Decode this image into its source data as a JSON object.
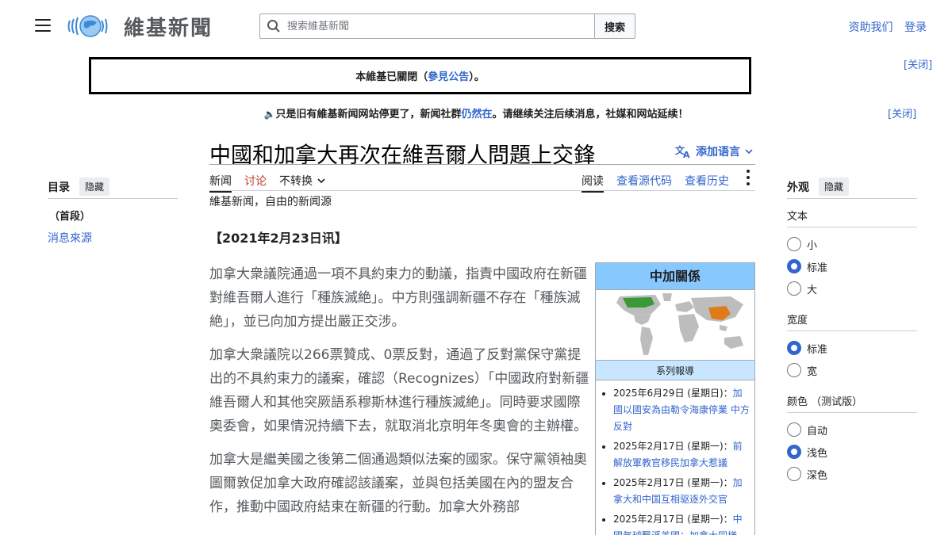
{
  "header": {
    "wordmark": "維基新聞",
    "search_placeholder": "搜索維基新聞",
    "search_button": "搜索",
    "donate": "资助我们",
    "login": "登录"
  },
  "notices": {
    "closed_prefix": "本維基已關閉（",
    "closed_link": "參見公告",
    "closed_suffix": "）。",
    "close_label": "[关闭]",
    "second_prefix": "只是旧有維基新闻网站停更了，新闻社群",
    "second_link": "仍然在",
    "second_suffix": "。请继续关注后续消息，社媒和网站延续！"
  },
  "page": {
    "title": "中國和加拿大再次在維吾爾人問題上交鋒",
    "add_languages": "添加语言",
    "tabs_left": [
      "新闻",
      "讨论",
      "不转换"
    ],
    "tabs_right": [
      "阅读",
      "查看源代码",
      "查看历史"
    ],
    "tagline": "維基新闻，自由的新闻源",
    "dateline": "【2021年2月23日讯】",
    "paragraphs": [
      "加拿大衆議院通過一項不具約束力的動議，指責中國政府在新疆對維吾爾人進行「種族滅絶」。中方則强調新疆不存在「種族滅絶」，並已向加方提出嚴正交涉。",
      "加拿大衆議院以266票贊成、0票反對，通過了反對黨保守黨提出的不具約束力的議案，確認（Recognizes）「中國政府對新疆維吾爾人和其他突厥語系穆斯林進行種族滅絶」。同時要求國際奧委會，如果情況持續下去，就取消北京明年冬奧會的主辦權。",
      "加拿大是繼美國之後第二個通過類似法案的國家。保守黨領袖奧圖爾敦促加拿大政府確認該議案，並與包括美國在內的盟友合作，推動中國政府結束在新疆的行動。加拿大外務部"
    ]
  },
  "infobox": {
    "title": "中加關係",
    "subtitle": "系列報導",
    "items": [
      {
        "date": "2025年6月29日 (星期日)：",
        "text": "加國以國安為由勒令海康停業 中方反對"
      },
      {
        "date": "2025年2月17日 (星期一)：",
        "text": "前解放軍教官移民加拿大惹議"
      },
      {
        "date": "2025年2月17日 (星期一)：",
        "text": "加拿大和中国互相驱逐外交官"
      },
      {
        "date": "2025年2月17日 (星期一)：",
        "text": "中國氣球飄浮美國：加拿大同樣"
      }
    ]
  },
  "toc": {
    "heading": "目录",
    "hide": "隐藏",
    "items": [
      "（首段）",
      "消息來源"
    ]
  },
  "appearance": {
    "heading": "外观",
    "hide": "隐藏",
    "text_label": "文本",
    "text_options": [
      "小",
      "标准",
      "大"
    ],
    "width_label": "宽度",
    "width_options": [
      "标准",
      "宽"
    ],
    "color_label": "颜色 （测试版）",
    "color_options": [
      "自动",
      "浅色",
      "深色"
    ]
  },
  "colors": {
    "link": "#3366cc",
    "infobox_header": "#87c8ff",
    "infobox_sub": "#c8e6ff",
    "map_canada": "#3a9a3a",
    "map_china": "#e07b1a"
  }
}
